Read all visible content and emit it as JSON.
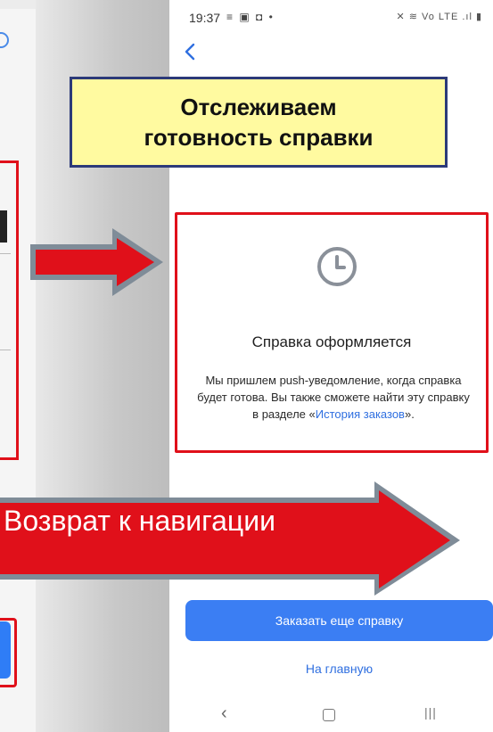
{
  "status_bar": {
    "time": "19:37",
    "left_icons": "≡ ▣ ◘ •",
    "right_icons": "✕ ≋ Vo LTE .ıl ▮"
  },
  "callout": {
    "line1": "Отслеживаем",
    "line2": "готовность справки"
  },
  "status_card": {
    "title": "Справка оформляется",
    "text_main": "Мы пришлем push-уведомление, когда справка будет готова. Вы также сможете найти эту справку в разделе «",
    "link_text": "История заказов",
    "text_end": "»."
  },
  "return_arrow": {
    "label": "Возврат к навигации"
  },
  "actions": {
    "order_more": "Заказать еще справку",
    "home": "На главную"
  },
  "nav_bar": {
    "back_icon": "‹",
    "recent_icon": "|||"
  },
  "colors": {
    "accent_blue": "#3b7ef3",
    "link_blue": "#2f6fe0",
    "highlight_red": "#e0101a",
    "callout_yellow": "#fffaa0",
    "callout_border": "#2c3a79",
    "clock_gray": "#8a9099"
  }
}
